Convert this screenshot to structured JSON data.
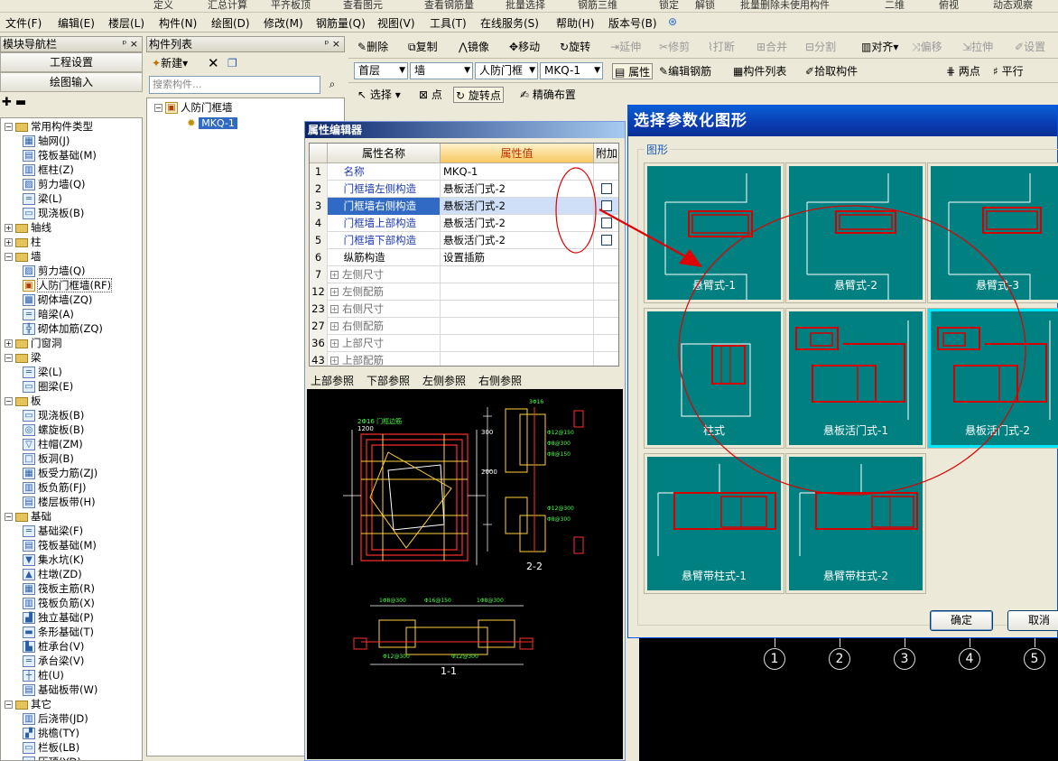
{
  "top_strip": [
    "定义",
    "汇总计算",
    "平齐板顶",
    "查看图元",
    "查看钢筋量",
    "批量选择",
    "钢筋三维",
    "锁定",
    "解锁",
    "批量删除未使用构件",
    "二维",
    "俯视",
    "动态观察"
  ],
  "menu": [
    "文件(F)",
    "编辑(E)",
    "楼层(L)",
    "构件(N)",
    "绘图(D)",
    "修改(M)",
    "钢筋量(Q)",
    "视图(V)",
    "工具(T)",
    "在线服务(S)",
    "帮助(H)",
    "版本号(B)"
  ],
  "nav": {
    "title": "模块导航栏",
    "pin": "ᵖ ×",
    "btn1": "工程设置",
    "btn2": "绘图输入"
  },
  "tree": [
    {
      "d": 0,
      "t": "常用构件类型",
      "f": 1
    },
    {
      "d": 1,
      "t": "轴网(J)",
      "i": "▦"
    },
    {
      "d": 1,
      "t": "筏板基础(M)",
      "i": "▤"
    },
    {
      "d": 1,
      "t": "框柱(Z)",
      "i": "▥"
    },
    {
      "d": 1,
      "t": "剪力墙(Q)",
      "i": "▨"
    },
    {
      "d": 1,
      "t": "梁(L)",
      "i": "═"
    },
    {
      "d": 1,
      "t": "现浇板(B)",
      "i": "▭"
    },
    {
      "d": 0,
      "t": "轴线",
      "f": 1,
      "c": 1
    },
    {
      "d": 0,
      "t": "柱",
      "f": 1,
      "c": 1
    },
    {
      "d": 0,
      "t": "墙",
      "f": 1
    },
    {
      "d": 1,
      "t": "剪力墙(Q)",
      "i": "▨"
    },
    {
      "d": 1,
      "t": "人防门框墙(RF)",
      "i": "▣",
      "s": 1
    },
    {
      "d": 1,
      "t": "砌体墙(ZQ)",
      "i": "▩"
    },
    {
      "d": 1,
      "t": "暗梁(A)",
      "i": "═"
    },
    {
      "d": 1,
      "t": "砌体加筋(ZQ)",
      "i": "╬"
    },
    {
      "d": 0,
      "t": "门窗洞",
      "f": 1,
      "c": 1
    },
    {
      "d": 0,
      "t": "梁",
      "f": 1
    },
    {
      "d": 1,
      "t": "梁(L)",
      "i": "═"
    },
    {
      "d": 1,
      "t": "圈梁(E)",
      "i": "▭"
    },
    {
      "d": 0,
      "t": "板",
      "f": 1
    },
    {
      "d": 1,
      "t": "现浇板(B)",
      "i": "▭"
    },
    {
      "d": 1,
      "t": "螺旋板(B)",
      "i": "◎"
    },
    {
      "d": 1,
      "t": "柱帽(ZM)",
      "i": "▽"
    },
    {
      "d": 1,
      "t": "板洞(B)",
      "i": "□"
    },
    {
      "d": 1,
      "t": "板受力筋(ZJ)",
      "i": "▦"
    },
    {
      "d": 1,
      "t": "板负筋(FJ)",
      "i": "▥"
    },
    {
      "d": 1,
      "t": "楼层板带(H)",
      "i": "▤"
    },
    {
      "d": 0,
      "t": "基础",
      "f": 1
    },
    {
      "d": 1,
      "t": "基础梁(F)",
      "i": "═"
    },
    {
      "d": 1,
      "t": "筏板基础(M)",
      "i": "▤"
    },
    {
      "d": 1,
      "t": "集水坑(K)",
      "i": "▼"
    },
    {
      "d": 1,
      "t": "柱墩(ZD)",
      "i": "▲"
    },
    {
      "d": 1,
      "t": "筏板主筋(R)",
      "i": "▦"
    },
    {
      "d": 1,
      "t": "筏板负筋(X)",
      "i": "▥"
    },
    {
      "d": 1,
      "t": "独立基础(P)",
      "i": "▟"
    },
    {
      "d": 1,
      "t": "条形基础(T)",
      "i": "▬"
    },
    {
      "d": 1,
      "t": "桩承台(V)",
      "i": "▙"
    },
    {
      "d": 1,
      "t": "承台梁(V)",
      "i": "═"
    },
    {
      "d": 1,
      "t": "桩(U)",
      "i": "┼"
    },
    {
      "d": 1,
      "t": "基础板带(W)",
      "i": "▤"
    },
    {
      "d": 0,
      "t": "其它",
      "f": 1
    },
    {
      "d": 1,
      "t": "后浇带(JD)",
      "i": "▥"
    },
    {
      "d": 1,
      "t": "挑檐(TY)",
      "i": "▞"
    },
    {
      "d": 1,
      "t": "栏板(LB)",
      "i": "▭"
    },
    {
      "d": 1,
      "t": "压顶(YD)",
      "i": "▬"
    }
  ],
  "complist": {
    "title": "构件列表",
    "new_btn": "新建",
    "search_placeholder": "搜索构件...",
    "root": "人防门框墙",
    "child": "MKQ-1"
  },
  "toolbar1": [
    "删除",
    "复制",
    "镜像",
    "移动",
    "旋转",
    "延伸",
    "修剪",
    "打断",
    "合并",
    "分割",
    "对齐",
    "偏移",
    "拉伸",
    "设置"
  ],
  "toolbar2": {
    "floor": "首层",
    "type": "墙",
    "subtype": "人防门框",
    "item": "MKQ-1",
    "attr": "属性",
    "edit": "编辑钢筋",
    "list": "构件列表",
    "pick": "拾取构件",
    "twopoint": "两点",
    "parallel": "平行"
  },
  "toolbar3": [
    "选择",
    "点",
    "旋转点",
    "精确布置"
  ],
  "pe": {
    "title": "属性编辑器",
    "col_name": "属性名称",
    "col_val": "属性值",
    "col_add": "附加",
    "rows": [
      {
        "n": "1",
        "k": "名称",
        "v": "MKQ-1",
        "cls": "blue",
        "chk": false
      },
      {
        "n": "2",
        "k": "门框墙左侧构造",
        "v": "悬板活门式-2",
        "cls": "blue",
        "chk": true
      },
      {
        "n": "3",
        "k": "门框墙右侧构造",
        "v": "悬板活门式-2",
        "cls": "blue",
        "chk": true,
        "hl": true
      },
      {
        "n": "4",
        "k": "门框墙上部构造",
        "v": "悬板活门式-2",
        "cls": "blue",
        "chk": true
      },
      {
        "n": "5",
        "k": "门框墙下部构造",
        "v": "悬板活门式-2",
        "cls": "blue",
        "chk": true
      },
      {
        "n": "6",
        "k": "纵筋构造",
        "v": "设置插筋",
        "cls": "",
        "chk": false
      },
      {
        "n": "7",
        "k": "左侧尺寸",
        "v": "",
        "cls": "gray",
        "exp": true
      },
      {
        "n": "12",
        "k": "左侧配筋",
        "v": "",
        "cls": "gray",
        "exp": true
      },
      {
        "n": "23",
        "k": "右侧尺寸",
        "v": "",
        "cls": "gray",
        "exp": true
      },
      {
        "n": "27",
        "k": "右侧配筋",
        "v": "",
        "cls": "gray",
        "exp": true
      },
      {
        "n": "36",
        "k": "上部尺寸",
        "v": "",
        "cls": "gray",
        "exp": true
      },
      {
        "n": "43",
        "k": "上部配筋",
        "v": "",
        "cls": "gray",
        "exp": true
      }
    ],
    "tabs": [
      "上部参照",
      "下部参照",
      "左侧参照",
      "右侧参照"
    ],
    "cad_labels": {
      "s22": "2-2",
      "s11": "1-1",
      "d2000": "2000",
      "d300": "300",
      "d1200": "1200"
    }
  },
  "dialog": {
    "title": "选择参数化图形",
    "group": "图形",
    "ok": "确定",
    "cancel": "取消",
    "tiles": [
      "悬臂式-1",
      "悬臂式-2",
      "悬臂式-3",
      "柱式",
      "悬板活门式-1",
      "悬板活门式-2",
      "悬臂带柱式-1",
      "悬臂带柱式-2"
    ],
    "selected": 5
  },
  "axis_numbers": [
    "1",
    "2",
    "3",
    "4",
    "5"
  ],
  "colors": {
    "teal": "#008080",
    "sel": "#00e8ff",
    "rebar": "#d40000",
    "annot": "#e00000"
  }
}
